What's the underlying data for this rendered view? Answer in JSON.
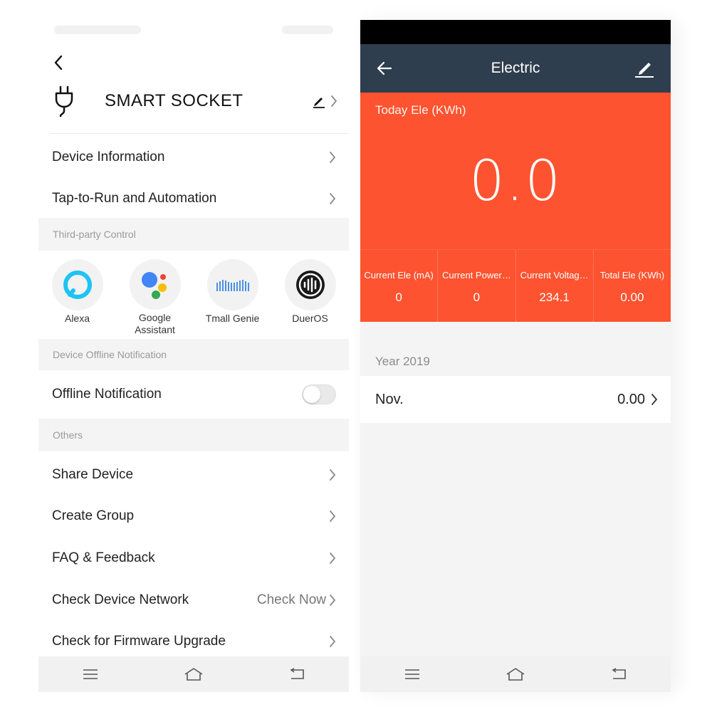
{
  "left": {
    "device_name": "SMART SOCKET",
    "icons": {
      "back": "chevron-left-icon",
      "device": "plug-icon",
      "edit": "pencil-icon",
      "chevron": "chevron-right-icon"
    },
    "menu_top": [
      {
        "label": "Device Information"
      },
      {
        "label": "Tap-to-Run and Automation"
      }
    ],
    "third_party_section": "Third-party Control",
    "assistants": [
      {
        "name": "Alexa",
        "icon": "alexa-icon"
      },
      {
        "name": "Google Assistant",
        "icon": "google-assistant-icon"
      },
      {
        "name": "Tmall Genie",
        "icon": "tmall-genie-icon"
      },
      {
        "name": "DuerOS",
        "icon": "dueros-icon"
      }
    ],
    "offline_section": "Device Offline Notification",
    "offline_label": "Offline Notification",
    "offline_enabled": false,
    "others_section": "Others",
    "menu_others": [
      {
        "label": "Share Device",
        "value": ""
      },
      {
        "label": "Create Group",
        "value": ""
      },
      {
        "label": "FAQ & Feedback",
        "value": ""
      },
      {
        "label": "Check Device Network",
        "value": "Check Now"
      },
      {
        "label": "Check for Firmware Upgrade",
        "value": ""
      }
    ],
    "navbar": [
      "menu-icon",
      "home-icon",
      "back-icon"
    ]
  },
  "right": {
    "title": "Electric",
    "icons": {
      "back": "arrow-left-icon",
      "edit": "pencil-underline-icon"
    },
    "today_caption": "Today Ele (KWh)",
    "today_value": "0.0",
    "stats": [
      {
        "label": "Current Ele (mA)",
        "value": "0"
      },
      {
        "label": "Current Power…",
        "value": "0"
      },
      {
        "label": "Current Voltag…",
        "value": "234.1"
      },
      {
        "label": "Total Ele (KWh)",
        "value": "0.00"
      }
    ],
    "year_label": "Year 2019",
    "months": [
      {
        "month": "Nov.",
        "value": "0.00"
      }
    ],
    "navbar": [
      "menu-icon",
      "home-icon",
      "back-icon"
    ]
  },
  "colors": {
    "accent_orange": "#fe5330",
    "topbar_navy": "#2f3e4e",
    "alexa_blue": "#1ec3f3"
  }
}
